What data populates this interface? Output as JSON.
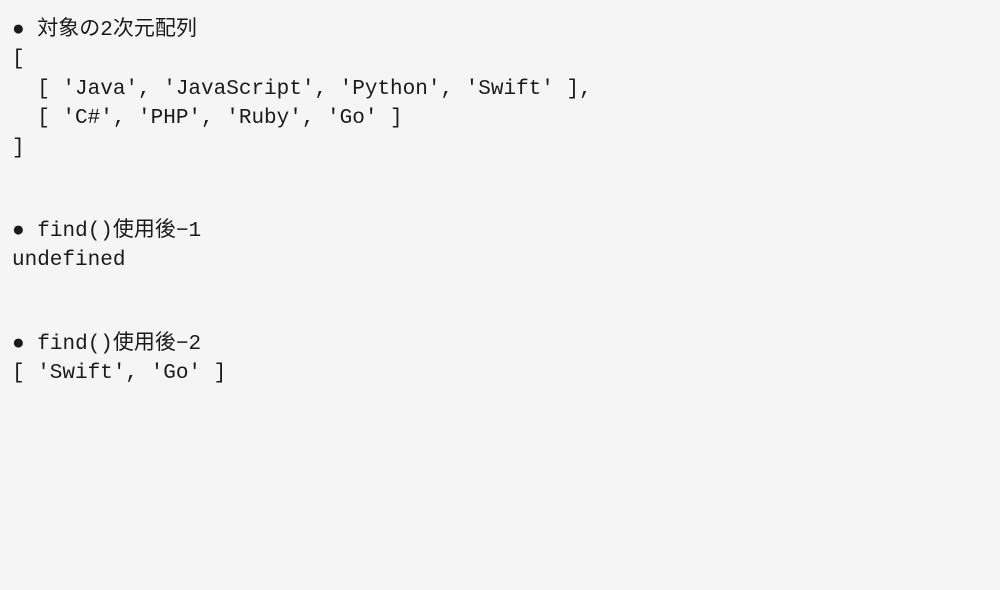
{
  "sections": [
    {
      "bullet": "●",
      "title": " 対象の2次元配列",
      "content": "[\n  [ 'Java', 'JavaScript', 'Python', 'Swift' ],\n  [ 'C#', 'PHP', 'Ruby', 'Go' ]\n]"
    },
    {
      "bullet": "●",
      "title": " find()使用後−1",
      "content": "undefined"
    },
    {
      "bullet": "●",
      "title": " find()使用後−2",
      "content": "[ 'Swift', 'Go' ]"
    }
  ]
}
